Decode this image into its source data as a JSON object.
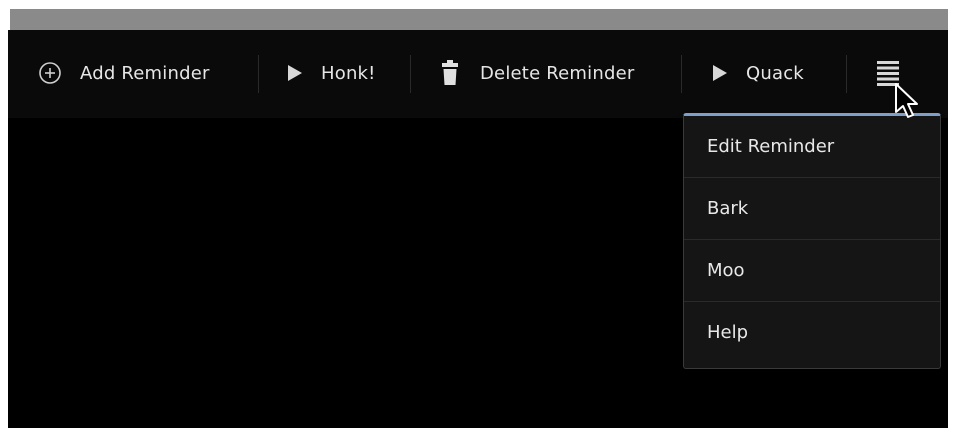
{
  "actionbar": {
    "add_label": "Add Reminder",
    "honk_label": "Honk!",
    "delete_label": "Delete Reminder",
    "quack_label": "Quack"
  },
  "overflow_menu": {
    "items": [
      {
        "label": "Edit Reminder"
      },
      {
        "label": "Bark"
      },
      {
        "label": "Moo"
      },
      {
        "label": "Help"
      }
    ]
  },
  "icons": {
    "add": "add-circle-icon",
    "honk": "play-icon",
    "delete": "trash-icon",
    "quack": "play-icon",
    "overflow": "overflow-menu-icon",
    "cursor": "mouse-pointer-icon"
  },
  "colors": {
    "background": "#000000",
    "text": "#e6e6e6",
    "menu_accent": "#7ea0c8"
  }
}
